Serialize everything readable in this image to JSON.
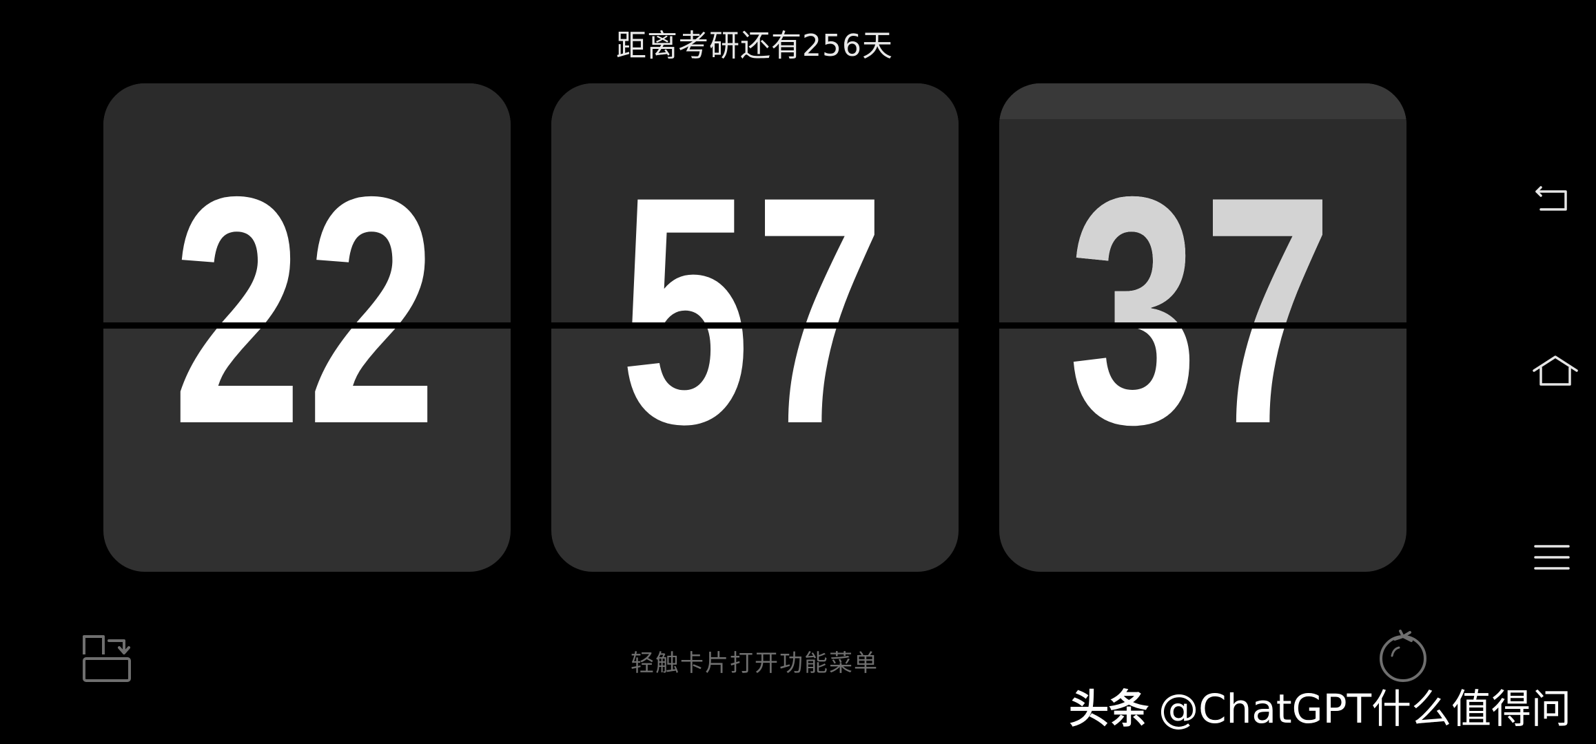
{
  "header": {
    "countdown_text": "距离考研还有256天"
  },
  "clock": {
    "hours": "22",
    "minutes": "57",
    "seconds": "37"
  },
  "footer": {
    "hint_text": "轻触卡片打开功能菜单"
  },
  "watermark": {
    "brand": "头条",
    "handle": "@ChatGPT什么值得问"
  },
  "nav": {
    "icons": [
      "back-icon",
      "home-icon",
      "menu-icon"
    ]
  },
  "colors": {
    "background": "#000000",
    "card": "#303030",
    "digit": "#ffffff",
    "hint": "#6f6f6f"
  }
}
